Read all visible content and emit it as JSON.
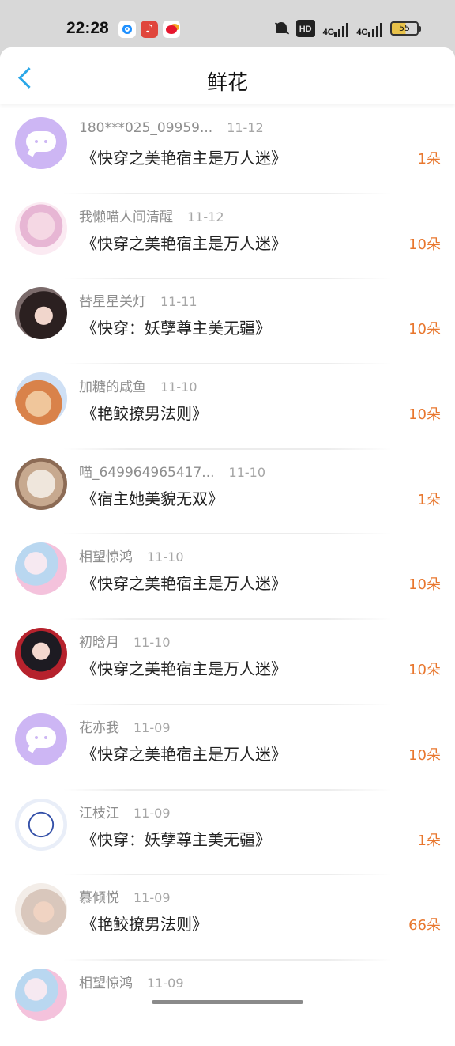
{
  "status": {
    "time": "22:28",
    "hd_label": "HD",
    "net1": "4G",
    "net2": "4G",
    "battery": "55"
  },
  "header": {
    "title": "鲜花"
  },
  "records": [
    {
      "user": "180***025_09959...",
      "date": "11-12",
      "book": "《快穿之美艳宿主是万人迷》",
      "count": "1朵",
      "avatar": "default"
    },
    {
      "user": "我懒喵人间清醒",
      "date": "11-12",
      "book": "《快穿之美艳宿主是万人迷》",
      "count": "10朵",
      "avatar": "photo1"
    },
    {
      "user": "替星星关灯",
      "date": "11-11",
      "book": "《快穿：妖孽尊主美无疆》",
      "count": "10朵",
      "avatar": "photo2"
    },
    {
      "user": "加糖的咸鱼",
      "date": "11-10",
      "book": "《艳鲛撩男法则》",
      "count": "10朵",
      "avatar": "photo3"
    },
    {
      "user": "喵_649964965417...",
      "date": "11-10",
      "book": "《宿主她美貌无双》",
      "count": "1朵",
      "avatar": "photo4"
    },
    {
      "user": "相望惊鸿",
      "date": "11-10",
      "book": "《快穿之美艳宿主是万人迷》",
      "count": "10朵",
      "avatar": "photo5"
    },
    {
      "user": "初晗月",
      "date": "11-10",
      "book": "《快穿之美艳宿主是万人迷》",
      "count": "10朵",
      "avatar": "photo6"
    },
    {
      "user": "花亦我",
      "date": "11-09",
      "book": "《快穿之美艳宿主是万人迷》",
      "count": "10朵",
      "avatar": "default"
    },
    {
      "user": "江枝江",
      "date": "11-09",
      "book": "《快穿：妖孽尊主美无疆》",
      "count": "1朵",
      "avatar": "photo7"
    },
    {
      "user": "慕倾悦",
      "date": "11-09",
      "book": "《艳鲛撩男法则》",
      "count": "66朵",
      "avatar": "photo8"
    },
    {
      "user": "相望惊鸿",
      "date": "11-09",
      "book": "",
      "count": "",
      "avatar": "photo5"
    }
  ]
}
